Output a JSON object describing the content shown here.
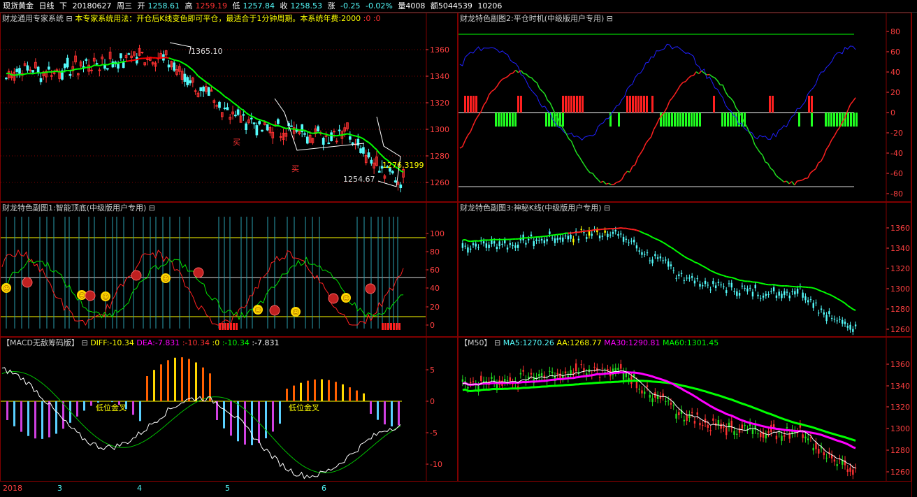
{
  "topbar": {
    "name": "现货黄金",
    "period": "日线",
    "direction": "下",
    "date": "20180627",
    "weekday": "周三",
    "open_label": "开",
    "open": "1258.61",
    "high_label": "高",
    "high": "1259.19",
    "low_label": "低",
    "low": "1257.84",
    "close_label": "收",
    "close": "1258.53",
    "change_label": "涨",
    "change": "-0.25",
    "change_pct": "-0.02%",
    "volume_label": "量4008",
    "amount_label": "额5044539",
    "extra": "10206"
  },
  "main": {
    "name": "财龙通用专家系统",
    "toggle": "⊟",
    "desc": "本专家系统用法：开仓后K线变色即可平仓，最适合于1分钟周期。本系统年费:2000",
    "tail": ":0 :0",
    "high_annot": "1365.10",
    "low_annot": "1254.67",
    "last_annot": "1276.3199",
    "buy1": "买",
    "buy2": "买",
    "yticks": [
      "1360",
      "1340",
      "1320",
      "1300",
      "1280",
      "1260"
    ]
  },
  "sub1": {
    "title": "财龙特色副图1:智能顶底(中级版用户专用)",
    "toggle": "⊟",
    "yticks": [
      "100",
      "80",
      "60",
      "40",
      "20",
      "0"
    ]
  },
  "sub2": {
    "title": "财龙特色副图2:平仓时机(中级版用户专用)",
    "toggle": "⊟",
    "yticks": [
      "80",
      "60",
      "40",
      "20",
      "0",
      "-20",
      "-40",
      "-60",
      "-80"
    ]
  },
  "sub3": {
    "title": "财龙特色副图3:神秘K线(中级版用户专用)",
    "toggle": "⊟",
    "yticks": [
      "1360",
      "1340",
      "1320",
      "1300",
      "1280",
      "1260"
    ]
  },
  "macd": {
    "title": "【MACD无敌筹码版】",
    "toggle": "⊟",
    "diff": "DIFF:-10.34",
    "dea": "DEA:-7.831",
    "v1": ":-10.34",
    "v2": ":0",
    "v3": ":-10.34",
    "v4": ":-7.831",
    "label1": "低位金叉",
    "label2": "低位金叉",
    "yticks": [
      "5",
      "0",
      "-5",
      "-10"
    ]
  },
  "ma": {
    "title": "【M50】",
    "toggle": "⊟",
    "ma5": "MA5:1270.26",
    "aa": "AA:1268.77",
    "ma30": "MA30:1290.81",
    "ma60": "MA60:1301.45",
    "yticks": [
      "1360",
      "1340",
      "1320",
      "1300",
      "1280",
      "1260"
    ]
  },
  "xaxis": {
    "labels": [
      "2018",
      "3",
      "4",
      "5",
      "6"
    ]
  },
  "colors": {
    "up": "#ff3232",
    "down": "#54fcfc",
    "grid": "#800000",
    "axis": "#ff4040",
    "green": "#00ff00",
    "blue": "#0000ff",
    "yellow": "#ffff00",
    "magenta": "#ff00ff"
  }
}
